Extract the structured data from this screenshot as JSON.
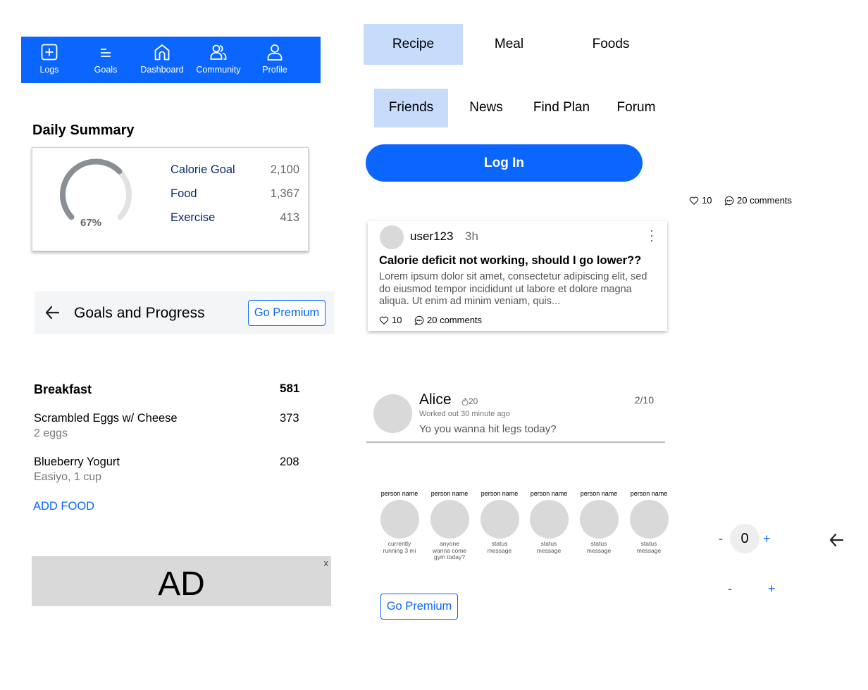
{
  "nav": {
    "items": [
      {
        "label": "Logs",
        "icon": "plus-square-icon"
      },
      {
        "label": "Goals",
        "icon": "goals-lines-icon"
      },
      {
        "label": "Dashboard",
        "icon": "home-icon"
      },
      {
        "label": "Community",
        "icon": "people-icon"
      },
      {
        "label": "Profile",
        "icon": "person-icon"
      }
    ],
    "bg_color": "#0a66ff"
  },
  "summary": {
    "title": "Daily Summary",
    "percent_label": "67%",
    "progress": 0.67,
    "rows": [
      {
        "label": "Calorie Goal",
        "value": "2,100"
      },
      {
        "label": "Food",
        "value": "1,367"
      },
      {
        "label": "Exercise",
        "value": "413"
      }
    ]
  },
  "goals_header": {
    "title": "Goals and Progress",
    "premium_label": "Go Premium"
  },
  "diary": {
    "meal": "Breakfast",
    "meal_total": "581",
    "items": [
      {
        "name": "Scrambled Eggs w/ Cheese",
        "detail": "2 eggs",
        "calories": "373"
      },
      {
        "name": "Blueberry Yogurt",
        "detail": "Easiyo, 1 cup",
        "calories": "208"
      }
    ],
    "add_label": "ADD FOOD"
  },
  "ad": {
    "text": "AD",
    "close": "x"
  },
  "food_tabs": [
    {
      "label": "Recipe",
      "active": true
    },
    {
      "label": "Meal",
      "active": false
    },
    {
      "label": "Foods",
      "active": false
    }
  ],
  "community_tabs": [
    {
      "label": "Friends",
      "active": true
    },
    {
      "label": "News",
      "active": false
    },
    {
      "label": "Find Plan",
      "active": false
    },
    {
      "label": "Forum",
      "active": false
    }
  ],
  "login_label": "Log In",
  "standalone_meta": {
    "likes": "10",
    "comments": "20 comments"
  },
  "post": {
    "user": "user123",
    "time": "3h",
    "title": "Calorie deficit not working, should I go lower??",
    "body": "Lorem ipsum dolor sit amet, consectetur adipiscing elit, sed do eiusmod tempor incididunt ut labore et dolore magna aliqua. Ut enim ad minim veniam, quis...",
    "likes": "10",
    "comments": "20 comments"
  },
  "message": {
    "name": "Alice",
    "streak": "20",
    "date": "2/10",
    "subtitle": "Worked out 30 minute ago",
    "text": "Yo you wanna hit legs today?"
  },
  "people": [
    {
      "name": "person name",
      "status": "currently running 3 mi"
    },
    {
      "name": "person name",
      "status": "anyone wanna come gym today?"
    },
    {
      "name": "person name",
      "status": "status message"
    },
    {
      "name": "person name",
      "status": "status message"
    },
    {
      "name": "person name",
      "status": "status message"
    },
    {
      "name": "person name",
      "status": "status message"
    }
  ],
  "premium_label_2": "Go Premium",
  "stepper": {
    "minus": "-",
    "value": "0",
    "plus": "+"
  },
  "stepper_small": {
    "minus": "-",
    "plus": "+"
  },
  "accent_color": "#0a66ff"
}
